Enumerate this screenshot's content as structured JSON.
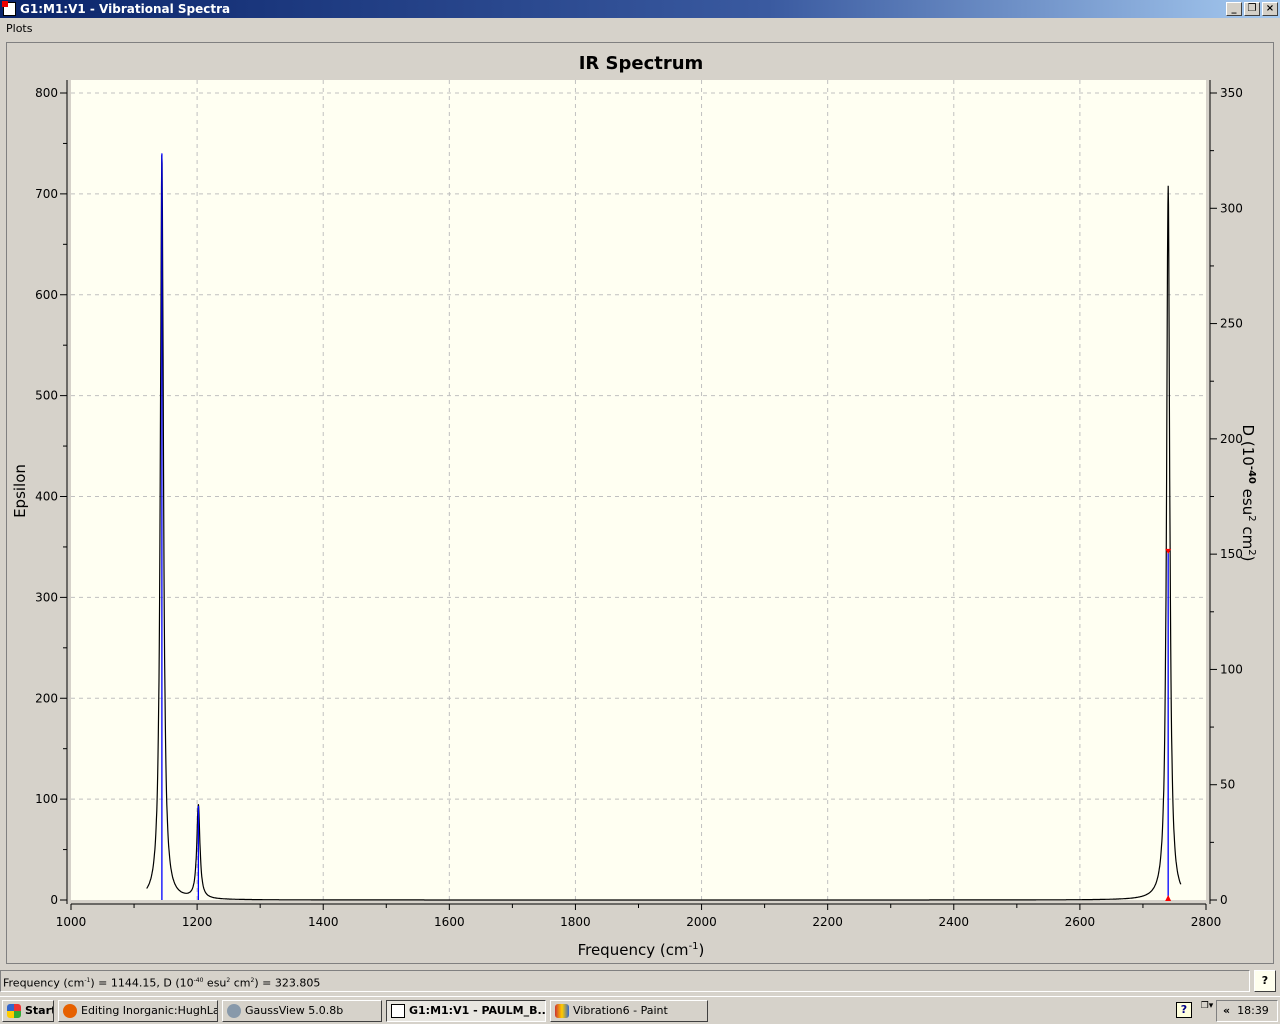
{
  "window": {
    "title": "G1:M1:V1 - Vibrational Spectra",
    "min": "_",
    "max": "❐",
    "close": "×"
  },
  "menu": {
    "plots": "Plots"
  },
  "chart_data": {
    "type": "line",
    "title": "IR Spectrum",
    "xlabel": "Frequency (cm",
    "xlabel_sup": "-1",
    "xlabel_end": ")",
    "ylabel": "Epsilon",
    "y2label": "D (10",
    "y2label_sup1": "-40",
    "y2label_mid": " esu",
    "y2label_sup2": "2",
    "y2label_mid2": " cm",
    "y2label_sup3": "2",
    "y2label_end": ")",
    "xlim": [
      1000,
      2800
    ],
    "ylim": [
      0,
      800
    ],
    "y2lim": [
      0,
      350
    ],
    "xticks": [
      1000,
      1200,
      1400,
      1600,
      1800,
      2000,
      2200,
      2400,
      2600,
      2800
    ],
    "yticks": [
      0,
      100,
      200,
      300,
      400,
      500,
      600,
      700,
      800
    ],
    "y2ticks": [
      0,
      50,
      100,
      150,
      200,
      250,
      300,
      350
    ],
    "grid": true,
    "curve_range": [
      1120,
      2760
    ],
    "hwhm": 3,
    "peaks": [
      {
        "freq": 1144.15,
        "epsilon": 740,
        "D": 323.805
      },
      {
        "freq": 1202,
        "epsilon": 93,
        "D": 40.8
      },
      {
        "freq": 2740,
        "epsilon": 708,
        "D": 151
      }
    ],
    "selected_marker": {
      "freq": 2740,
      "D": 151
    },
    "colors": {
      "curve": "#000000",
      "stick": "#0000ff",
      "marker": "#ff0000",
      "grid": "#c0c0c0",
      "plot_bg": "#fffff2"
    }
  },
  "status": {
    "p1": "Frequency (cm",
    "s1": "-1",
    "p2": ") = 1144.15, D (10",
    "s2": "-40",
    "p3": " esu",
    "s3": "2",
    "p4": " cm",
    "s4": "2",
    "p5": ") = 323.805",
    "help": "?"
  },
  "taskbar": {
    "start": "Start",
    "items": [
      "Editing Inorganic:HughLa...",
      "GaussView 5.0.8b",
      "G1:M1:V1 - PAULM_B...",
      "Vibration6 - Paint"
    ],
    "clock": "18:39",
    "chevron": "«"
  }
}
